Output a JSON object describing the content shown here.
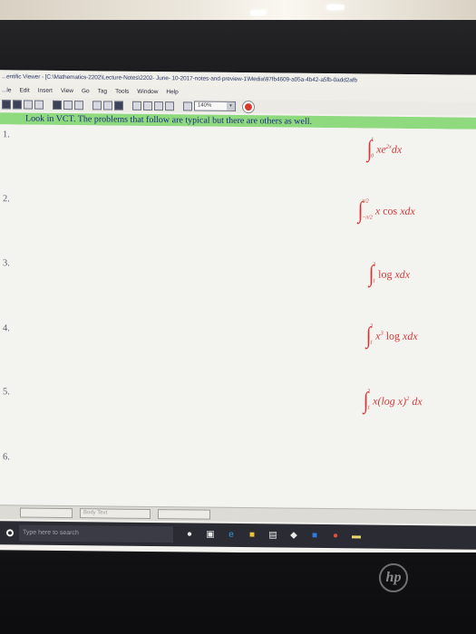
{
  "window": {
    "title": "...entific Viewer - [C:\\Mathematics-2202\\Lecture-Notes\\2202- June- 10-2017-notes-and-preview-1\\Media\\97fb4609-a05a-4b42-a5fb-0add2afb",
    "menu": [
      "...le",
      "Edit",
      "Insert",
      "View",
      "Go",
      "Tag",
      "Tools",
      "Window",
      "Help"
    ]
  },
  "toolbar": {
    "zoom": "140%",
    "zoom_dropdown": "▾"
  },
  "banner": {
    "text": "Look in VCT. The problems that follow are typical but there are others as well."
  },
  "problems": [
    {
      "number": "1.",
      "integral": "∫",
      "upper": "1",
      "lower": "0",
      "integrand": "xe",
      "exp": "2x",
      "differential": "dx"
    },
    {
      "number": "2.",
      "integral": "∫",
      "upper": "π/2",
      "lower": "−π/2",
      "integrand": "x",
      "fn": "cos",
      "arg": "x",
      "differential": "dx"
    },
    {
      "number": "3.",
      "integral": "∫",
      "upper": "3",
      "lower": "1",
      "fn": "log",
      "arg": "x",
      "differential": "dx"
    },
    {
      "number": "4.",
      "integral": "∫",
      "upper": "2",
      "lower": "1",
      "integrand": "x",
      "exp": "3",
      "fn": "log",
      "arg": "x",
      "differential": "dx"
    },
    {
      "number": "5.",
      "integral": "∫",
      "upper": "2",
      "lower": "1",
      "integrand": "x(log x)",
      "exp": "2",
      "differential": "dx"
    },
    {
      "number": "6."
    }
  ],
  "statusbar": {
    "field_label": "Body Text"
  },
  "taskbar": {
    "search_placeholder": "Type here to search",
    "icons": [
      "microphone-icon",
      "task-view-icon",
      "edge-icon",
      "file-explorer-icon",
      "store-icon",
      "dropbox-icon",
      "app-icon",
      "chrome-icon",
      "folder-icon"
    ]
  },
  "brand": {
    "logo_text": "hp"
  },
  "colors": {
    "banner_bg": "#8fd97e",
    "banner_text": "#1c2a80",
    "formula": "#d23a3a",
    "taskbar": "#2b2c33"
  }
}
